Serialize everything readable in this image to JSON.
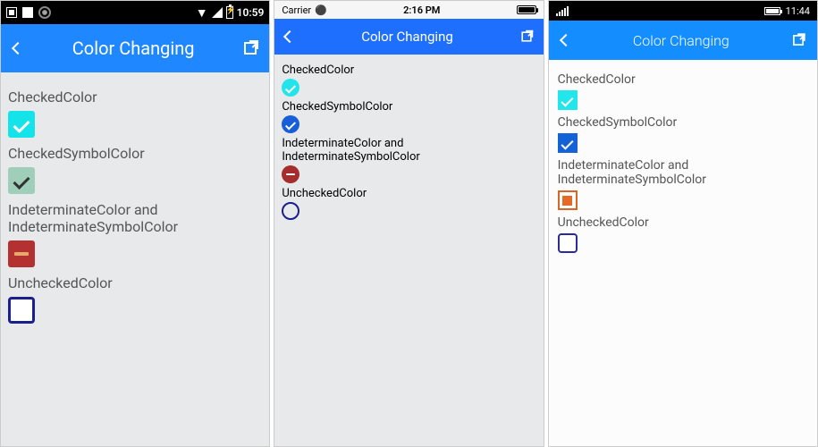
{
  "android": {
    "status_time": "10:59",
    "appbar_title": "Color Changing",
    "labels": {
      "checked": "CheckedColor",
      "symbol": "CheckedSymbolColor",
      "indeterminate": "IndeterminateColor and IndeterminateSymbolColor",
      "unchecked": "UncheckedColor"
    }
  },
  "ios": {
    "status_carrier": "Carrier",
    "status_time": "2:16 PM",
    "appbar_title": "Color Changing",
    "labels": {
      "checked": "CheckedColor",
      "symbol": "CheckedSymbolColor",
      "indeterminate": "IndeterminateColor and IndeterminateSymbolColor",
      "unchecked": "UncheckedColor"
    }
  },
  "uwp": {
    "status_time": "11:44",
    "appbar_title": "Color Changing",
    "labels": {
      "checked": "CheckedColor",
      "symbol": "CheckedSymbolColor",
      "indeterminate": "IndeterminateColor and IndeterminateSymbolColor",
      "unchecked": "UncheckedColor"
    }
  }
}
